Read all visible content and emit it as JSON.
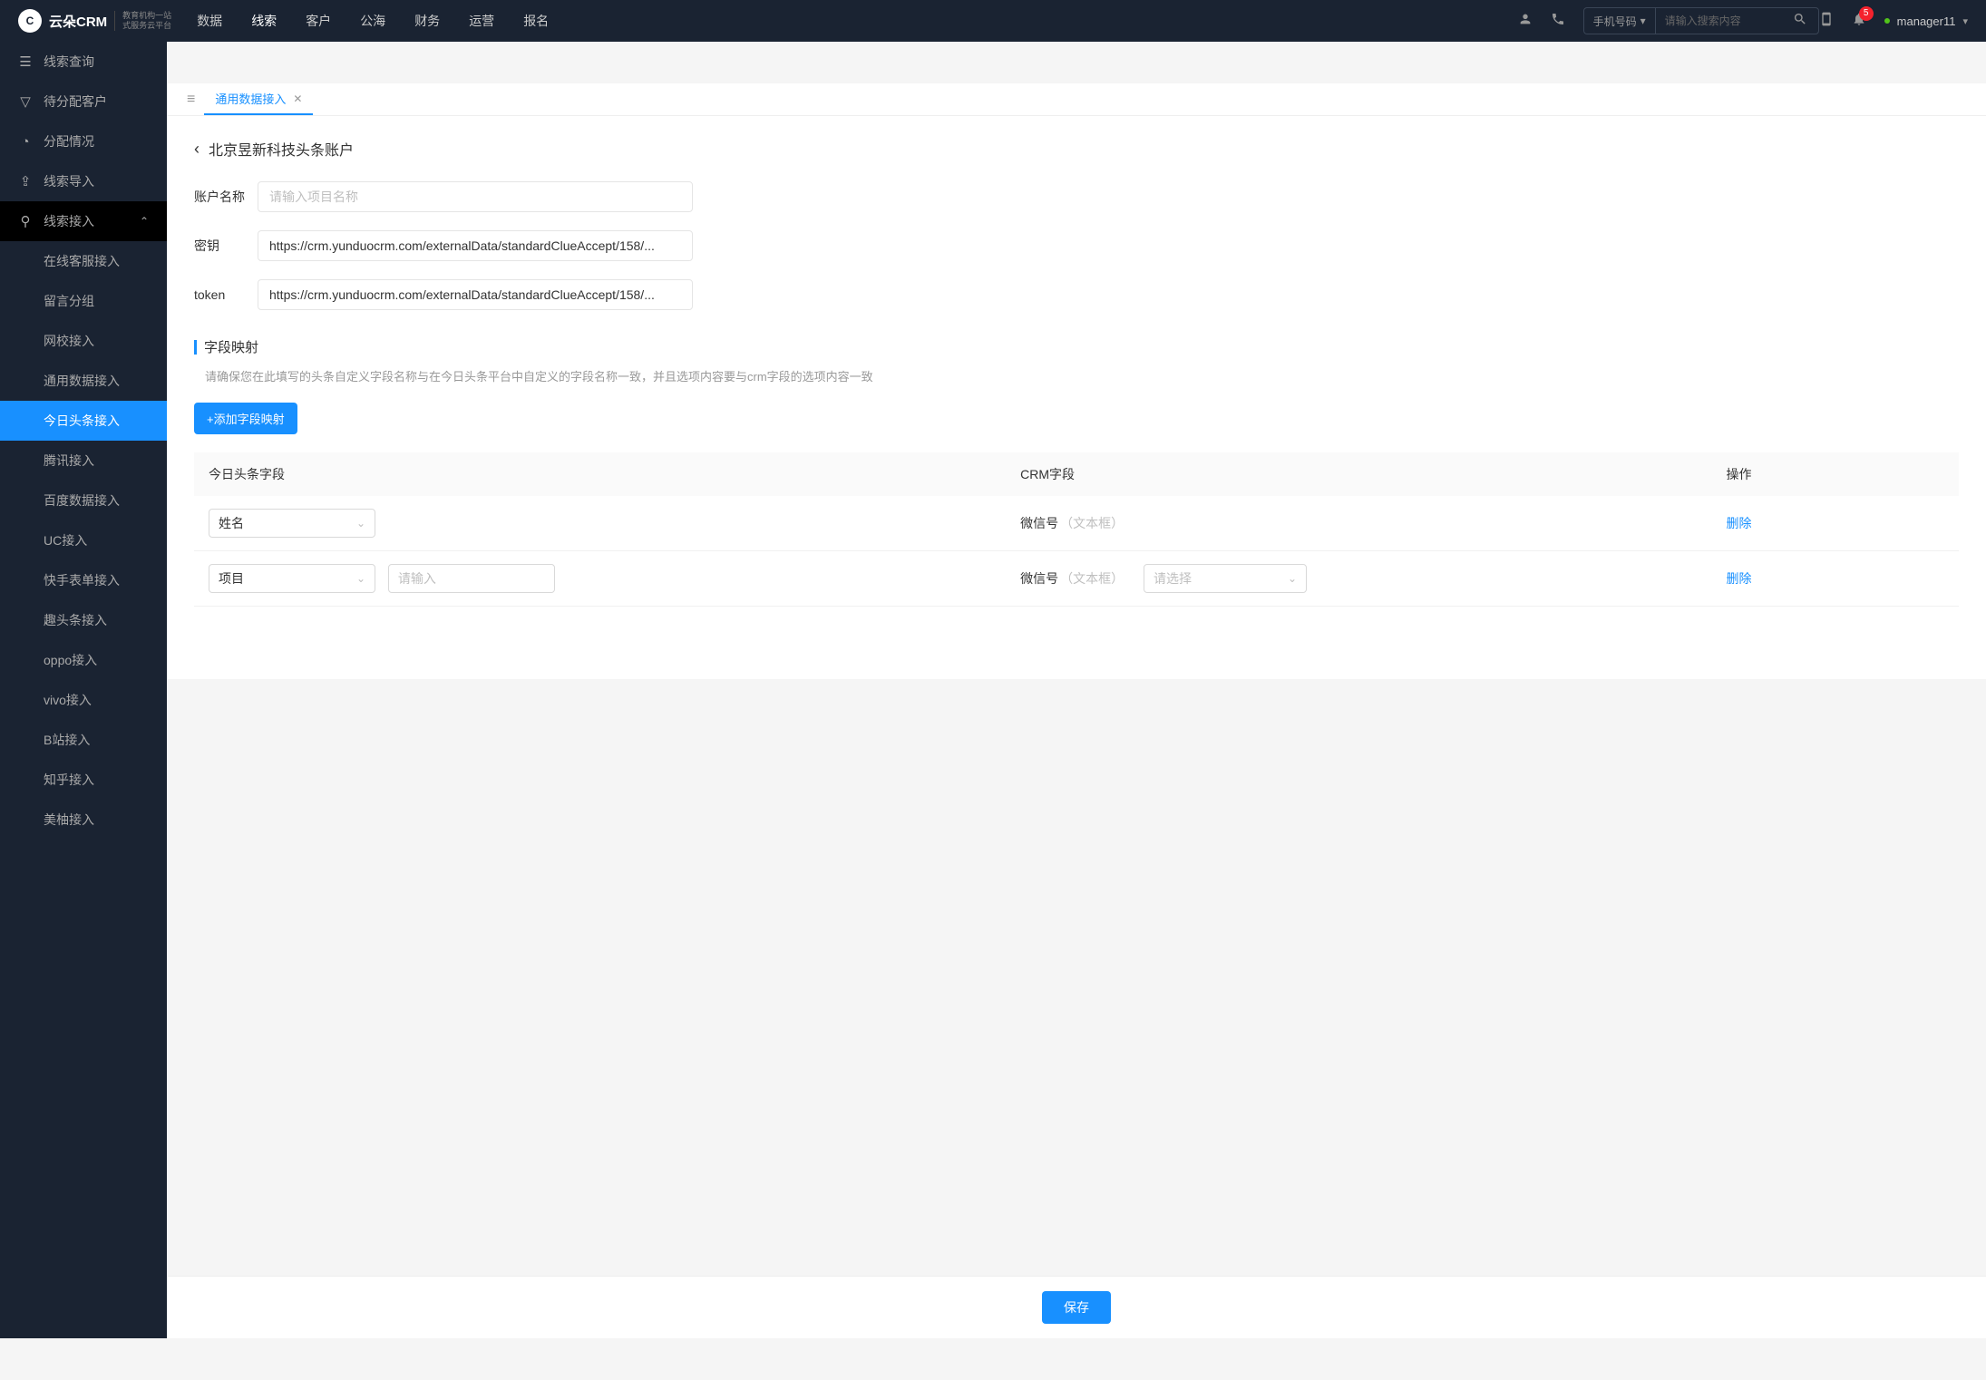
{
  "header": {
    "logo_text": "云朵CRM",
    "logo_sub1": "教育机构一站",
    "logo_sub2": "式服务云平台",
    "nav": [
      "数据",
      "线索",
      "客户",
      "公海",
      "财务",
      "运营",
      "报名"
    ],
    "nav_active": 1,
    "search_type": "手机号码",
    "search_placeholder": "请输入搜索内容",
    "badge_count": "5",
    "user_name": "manager11"
  },
  "sidebar": {
    "items": [
      {
        "icon": "list",
        "label": "线索查询"
      },
      {
        "icon": "filter",
        "label": "待分配客户"
      },
      {
        "icon": "pie",
        "label": "分配情况"
      },
      {
        "icon": "import",
        "label": "线索导入"
      },
      {
        "icon": "plug",
        "label": "线索接入",
        "expanded": true
      }
    ],
    "sub_items": [
      "在线客服接入",
      "留言分组",
      "网校接入",
      "通用数据接入",
      "今日头条接入",
      "腾讯接入",
      "百度数据接入",
      "UC接入",
      "快手表单接入",
      "趣头条接入",
      "oppo接入",
      "vivo接入",
      "B站接入",
      "知乎接入",
      "美柚接入"
    ],
    "sub_active": 4
  },
  "tabs": {
    "active_tab": "通用数据接入"
  },
  "page": {
    "breadcrumb_title": "北京昱新科技头条账户",
    "form": {
      "name_label": "账户名称",
      "name_placeholder": "请输入项目名称",
      "key_label": "密钥",
      "key_value": "https://crm.yunduocrm.com/externalData/standardClueAccept/158/...",
      "token_label": "token",
      "token_value": "https://crm.yunduocrm.com/externalData/standardClueAccept/158/..."
    },
    "section": {
      "title": "字段映射",
      "desc": "请确保您在此填写的头条自定义字段名称与在今日头条平台中自定义的字段名称一致，并且选项内容要与crm字段的选项内容一致",
      "add_button": "+添加字段映射"
    },
    "table": {
      "headers": [
        "今日头条字段",
        "CRM字段",
        "操作"
      ],
      "rows": [
        {
          "field": "姓名",
          "crm_field": "微信号",
          "crm_type": "（文本框）",
          "action": "删除"
        },
        {
          "field": "项目",
          "input_placeholder": "请输入",
          "crm_field": "微信号",
          "crm_type": "（文本框）",
          "select_placeholder": "请选择",
          "action": "删除"
        }
      ]
    },
    "save_button": "保存"
  }
}
